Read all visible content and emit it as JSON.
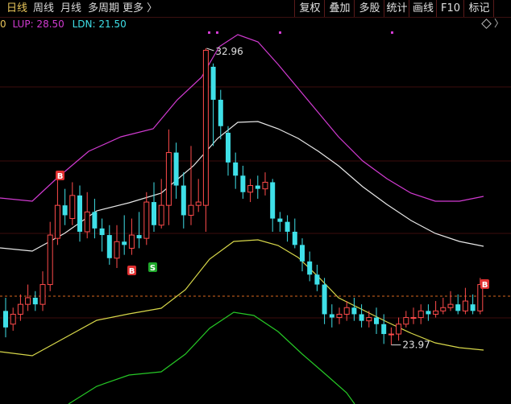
{
  "toolbar": {
    "tabs": [
      {
        "label": "日线",
        "active": true
      },
      {
        "label": "周线",
        "active": false
      },
      {
        "label": "月线",
        "active": false
      },
      {
        "label": "多周期",
        "active": false
      },
      {
        "label": "更多 〉",
        "active": false
      }
    ],
    "tools": [
      "复权",
      "叠加",
      "多股",
      "统计",
      "画线",
      "F10",
      "标记"
    ]
  },
  "legend": {
    "partial": "0",
    "lup": "LUP: 28.50",
    "ldn": "LDN: 21.50"
  },
  "annotations": {
    "high": "32.96",
    "low": "23.97",
    "buy": "B",
    "sell": "S"
  },
  "colors": {
    "up": "#ff4b4b",
    "down": "#3fe0e8",
    "upper_band": "#d23bd2",
    "mid_band": "#e8e8e8",
    "lower_band": "#d8d84a",
    "green_band": "#26c826",
    "lup_text": "#d23bd2",
    "ldn_text": "#3fe0e8",
    "dashed_line": "#d8661e"
  },
  "chart_data": {
    "type": "candlestick",
    "title": "",
    "high_label": 32.96,
    "low_label": 23.97,
    "lup": 28.5,
    "ldn": 21.5,
    "candles": [
      [
        25.0,
        24.5,
        25.4,
        24.2
      ],
      [
        24.6,
        24.9,
        25.1,
        24.4
      ],
      [
        24.9,
        25.2,
        25.5,
        24.7
      ],
      [
        25.2,
        25.4,
        25.8,
        25.0
      ],
      [
        25.4,
        25.2,
        25.6,
        25.0
      ],
      [
        25.2,
        25.8,
        26.2,
        25.0
      ],
      [
        25.8,
        27.3,
        27.7,
        25.6
      ],
      [
        27.2,
        28.2,
        29.1,
        27.0
      ],
      [
        28.2,
        27.9,
        28.7,
        27.6
      ],
      [
        27.8,
        28.5,
        28.9,
        27.6
      ],
      [
        28.5,
        27.4,
        28.8,
        27.1
      ],
      [
        27.4,
        28.0,
        28.6,
        27.2
      ],
      [
        28.0,
        27.5,
        28.4,
        27.2
      ],
      [
        27.5,
        27.3,
        27.8,
        26.8
      ],
      [
        27.3,
        26.6,
        27.6,
        26.4
      ],
      [
        26.6,
        27.1,
        27.6,
        26.3
      ],
      [
        27.1,
        27.0,
        27.9,
        26.7
      ],
      [
        26.9,
        27.3,
        27.8,
        26.7
      ],
      [
        27.3,
        27.2,
        28.0,
        26.9
      ],
      [
        27.2,
        28.3,
        28.6,
        27.0
      ],
      [
        28.3,
        27.6,
        28.9,
        27.4
      ],
      [
        27.6,
        28.2,
        29.0,
        27.5
      ],
      [
        28.2,
        29.8,
        30.5,
        27.6
      ],
      [
        29.8,
        28.8,
        30.1,
        28.4
      ],
      [
        28.8,
        27.9,
        29.2,
        27.5
      ],
      [
        27.9,
        28.2,
        30.0,
        27.6
      ],
      [
        28.2,
        28.3,
        29.0,
        28.0
      ],
      [
        28.2,
        32.9,
        32.96,
        27.4
      ],
      [
        32.4,
        31.4,
        32.5,
        30.0
      ],
      [
        31.4,
        30.6,
        31.7,
        30.2
      ],
      [
        30.4,
        29.5,
        30.6,
        29.1
      ],
      [
        29.5,
        29.1,
        29.8,
        28.7
      ],
      [
        29.1,
        28.6,
        29.4,
        28.4
      ],
      [
        28.6,
        28.8,
        29.0,
        28.3
      ],
      [
        28.8,
        28.7,
        29.1,
        28.4
      ],
      [
        28.7,
        28.9,
        29.2,
        28.5
      ],
      [
        28.9,
        27.8,
        29.0,
        27.4
      ],
      [
        27.8,
        27.7,
        28.0,
        27.4
      ],
      [
        27.7,
        27.4,
        27.9,
        27.1
      ],
      [
        27.4,
        27.0,
        27.8,
        26.9
      ],
      [
        27.0,
        26.5,
        27.2,
        26.2
      ],
      [
        26.5,
        26.1,
        26.8,
        25.9
      ],
      [
        26.1,
        25.8,
        26.4,
        25.6
      ],
      [
        25.8,
        24.9,
        26.0,
        24.6
      ],
      [
        24.9,
        24.8,
        25.2,
        24.5
      ],
      [
        24.8,
        24.9,
        25.1,
        24.6
      ],
      [
        24.9,
        25.1,
        25.3,
        24.7
      ],
      [
        25.1,
        24.9,
        25.4,
        24.7
      ],
      [
        24.9,
        24.7,
        25.2,
        24.5
      ],
      [
        24.7,
        24.8,
        25.0,
        24.5
      ],
      [
        24.8,
        24.6,
        25.1,
        24.3
      ],
      [
        24.6,
        24.3,
        24.9,
        24.0
      ],
      [
        24.3,
        24.3,
        24.5,
        23.97
      ],
      [
        24.3,
        24.6,
        24.8,
        24.1
      ],
      [
        24.6,
        24.8,
        25.0,
        24.5
      ],
      [
        24.8,
        24.8,
        25.1,
        24.6
      ],
      [
        24.8,
        25.0,
        25.2,
        24.6
      ],
      [
        25.0,
        24.9,
        25.2,
        24.7
      ],
      [
        24.9,
        25.0,
        25.3,
        24.8
      ],
      [
        25.0,
        25.1,
        25.4,
        24.9
      ],
      [
        25.1,
        25.2,
        25.6,
        25.0
      ],
      [
        25.2,
        25.0,
        25.5,
        24.9
      ],
      [
        25.0,
        25.3,
        25.7,
        24.9
      ],
      [
        25.2,
        25.0,
        25.5,
        24.9
      ],
      [
        25.0,
        25.8,
        26.0,
        24.9
      ]
    ]
  }
}
